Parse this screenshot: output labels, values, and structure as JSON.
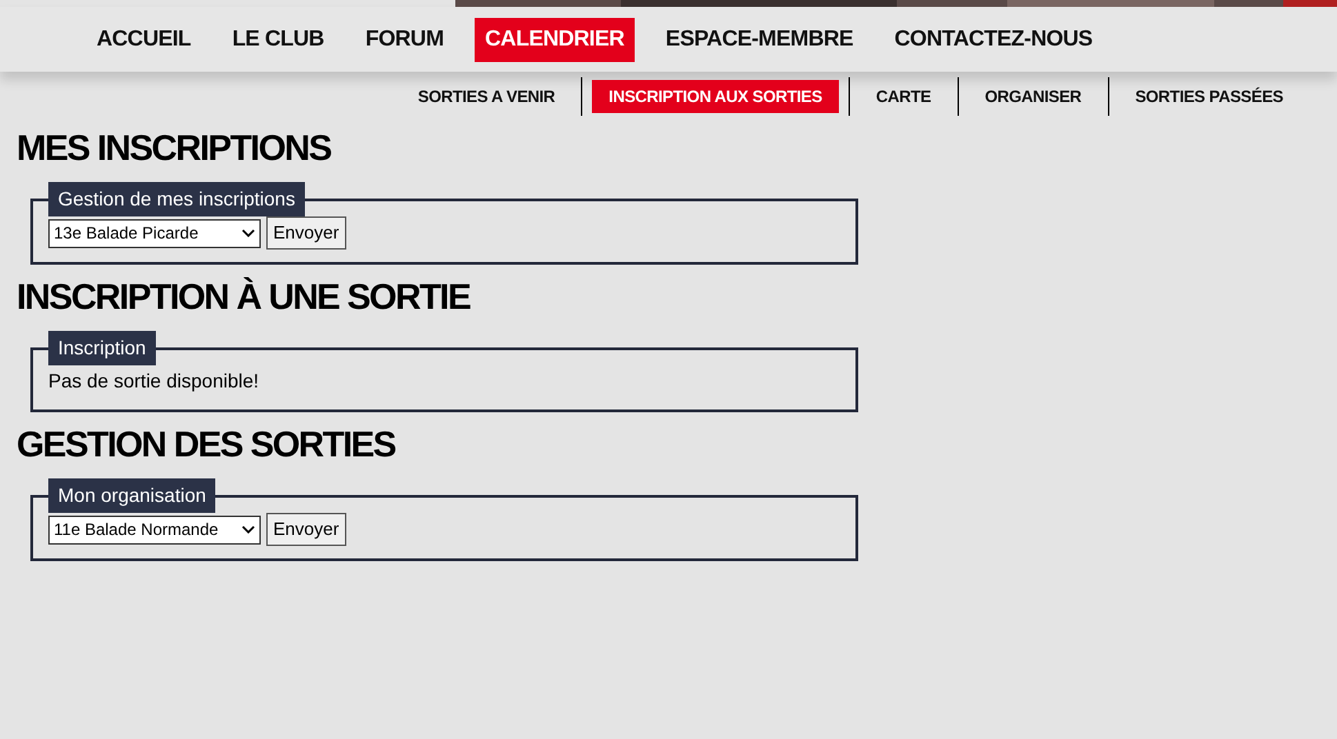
{
  "main_nav": [
    {
      "label": "ACCUEIL",
      "selected": false
    },
    {
      "label": "LE CLUB",
      "selected": false
    },
    {
      "label": "FORUM",
      "selected": false
    },
    {
      "label": "CALENDRIER",
      "selected": true
    },
    {
      "label": "ESPACE-MEMBRE",
      "selected": false
    },
    {
      "label": "CONTACTEZ-NOUS",
      "selected": false
    }
  ],
  "sub_nav": [
    {
      "label": "SORTIES A VENIR",
      "selected": false
    },
    {
      "label": "INSCRIPTION AUX SORTIES",
      "selected": true
    },
    {
      "label": "CARTE",
      "selected": false
    },
    {
      "label": "ORGANISER",
      "selected": false
    },
    {
      "label": "SORTIES PASSÉES",
      "selected": false
    }
  ],
  "sections": [
    {
      "heading": "MES INSCRIPTIONS",
      "legend": "Gestion de mes inscriptions",
      "kind": "form",
      "select_value": "13e Balade Picarde",
      "button": "Envoyer"
    },
    {
      "heading": "INSCRIPTION À UNE SORTIE",
      "legend": "Inscription",
      "kind": "message",
      "message": "Pas de sortie disponible!"
    },
    {
      "heading": "GESTION DES SORTIES",
      "legend": "Mon organisation",
      "kind": "form",
      "select_value": "11e Balade Normande",
      "button": "Envoyer"
    }
  ]
}
